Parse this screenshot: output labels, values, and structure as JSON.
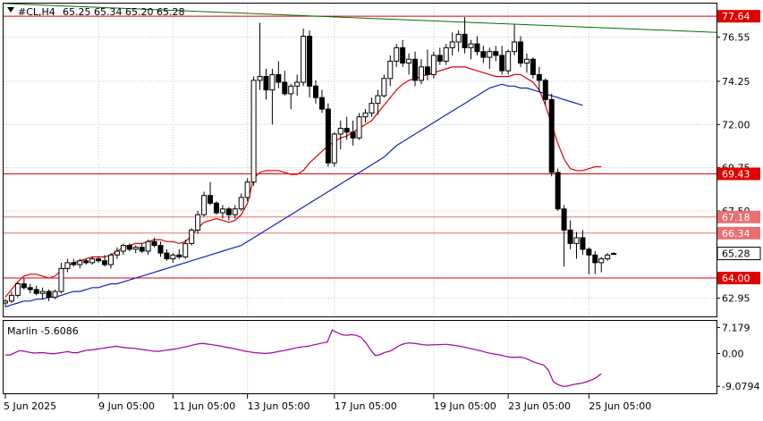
{
  "header": {
    "symbol": "#CL,H4",
    "ohlc": "65.25 65.34 65.20 65.28"
  },
  "indicator": {
    "label": "Marlin -5.6086",
    "levels": [
      "7.179",
      "0.00",
      "-9.0794"
    ],
    "values": [
      -0.4,
      -0.4,
      0.2,
      0.8,
      0.6,
      0.3,
      0.1,
      0.2,
      0.2,
      0.0,
      -0.1,
      0.1,
      0.3,
      0.5,
      0.2,
      0.2,
      0.6,
      0.9,
      1.0,
      1.2,
      1.4,
      1.6,
      1.8,
      2.0,
      1.8,
      1.6,
      1.5,
      1.4,
      1.2,
      1.0,
      0.8,
      0.6,
      0.6,
      0.8,
      1.0,
      1.2,
      1.4,
      1.7,
      2.0,
      2.3,
      2.6,
      2.8,
      2.6,
      2.4,
      2.2,
      2.0,
      1.7,
      1.5,
      1.2,
      0.9,
      0.6,
      0.4,
      0.2,
      0.1,
      0.0,
      0.1,
      0.3,
      0.6,
      0.8,
      1.1,
      1.4,
      1.7,
      1.9,
      2.0,
      2.3,
      2.6,
      2.9,
      3.2,
      6.5,
      5.8,
      5.2,
      5.0,
      5.2,
      5.0,
      4.5,
      3.0,
      1.0,
      -0.6,
      -0.3,
      0.3,
      0.6,
      1.4,
      2.2,
      2.7,
      2.9,
      2.8,
      2.6,
      2.4,
      2.3,
      2.4,
      2.4,
      2.5,
      2.5,
      2.3,
      2.1,
      1.9,
      1.6,
      1.3,
      1.0,
      0.7,
      0.3,
      0.0,
      -0.2,
      -0.4,
      -0.8,
      -1.0,
      -1.1,
      -1.0,
      -1.2,
      -1.8,
      -2.4,
      -2.8,
      -3.2,
      -4.6,
      -7.8,
      -8.6,
      -9.1,
      -9.0,
      -8.6,
      -8.4,
      -8.2,
      -7.8,
      -7.3,
      -6.6,
      -5.6
    ]
  },
  "price_axis": {
    "ticks": [
      "76.55",
      "74.25",
      "72.00",
      "69.75",
      "67.50",
      "65.28",
      "62.95"
    ],
    "current": "65.28"
  },
  "levels": [
    {
      "label": "77.64",
      "value": 77.64
    },
    {
      "label": "69.43",
      "value": 69.43
    },
    {
      "label": "67.18",
      "value": 67.18
    },
    {
      "label": "66.34",
      "value": 66.34
    },
    {
      "label": "64.00",
      "value": 64.0
    }
  ],
  "time_axis": {
    "ticks": [
      "5 Jun 2025",
      "9 Jun 05:00",
      "11 Jun 05:00",
      "13 Jun 05:00",
      "17 Jun 05:00",
      "19 Jun 05:00",
      "23 Jun 05:00",
      "25 Jun 05:00"
    ]
  },
  "colors": {
    "bull": "#ffffff",
    "bear": "#000000",
    "level_red": "#e00000",
    "level_box": "#e00000",
    "level_box_light": "#e87070",
    "band_red": "#e00000",
    "ma_blue": "#1020c0",
    "trend_green": "#007000",
    "marlin": "#a000a0",
    "grid": "#c8c8c8"
  },
  "chart_data": {
    "type": "candlestick",
    "title": "#CL,H4",
    "candles": [
      [
        62.7,
        62.9,
        62.5,
        62.8
      ],
      [
        62.8,
        63.3,
        62.7,
        63.1
      ],
      [
        63.1,
        63.8,
        63.0,
        63.7
      ],
      [
        63.7,
        64.0,
        63.4,
        63.5
      ],
      [
        63.5,
        63.7,
        63.2,
        63.4
      ],
      [
        63.4,
        63.6,
        63.1,
        63.2
      ],
      [
        63.2,
        63.5,
        62.9,
        63.3
      ],
      [
        63.3,
        63.4,
        62.8,
        63.0
      ],
      [
        63.0,
        63.4,
        62.9,
        63.3
      ],
      [
        63.3,
        64.8,
        63.2,
        64.5
      ],
      [
        64.5,
        65.0,
        64.3,
        64.8
      ],
      [
        64.8,
        65.0,
        64.6,
        64.7
      ],
      [
        64.7,
        65.0,
        64.5,
        64.9
      ],
      [
        64.9,
        65.0,
        64.7,
        64.8
      ],
      [
        64.8,
        65.1,
        64.7,
        65.0
      ],
      [
        65.0,
        65.1,
        64.8,
        64.9
      ],
      [
        64.9,
        65.2,
        64.6,
        64.7
      ],
      [
        64.7,
        65.3,
        64.5,
        65.2
      ],
      [
        65.2,
        65.6,
        65.0,
        65.4
      ],
      [
        65.4,
        65.8,
        65.2,
        65.7
      ],
      [
        65.7,
        65.8,
        65.4,
        65.5
      ],
      [
        65.5,
        65.7,
        65.3,
        65.6
      ],
      [
        65.6,
        65.8,
        65.3,
        65.4
      ],
      [
        65.4,
        66.0,
        65.2,
        65.9
      ],
      [
        65.9,
        66.1,
        65.6,
        65.7
      ],
      [
        65.7,
        65.9,
        65.1,
        65.3
      ],
      [
        65.3,
        65.5,
        64.9,
        65.0
      ],
      [
        65.0,
        65.3,
        64.8,
        65.2
      ],
      [
        65.2,
        65.5,
        65.0,
        65.1
      ],
      [
        65.1,
        66.0,
        65.0,
        65.8
      ],
      [
        65.8,
        66.6,
        65.7,
        66.5
      ],
      [
        66.5,
        67.5,
        66.3,
        67.3
      ],
      [
        67.3,
        68.5,
        67.2,
        68.3
      ],
      [
        68.3,
        69.0,
        67.8,
        67.9
      ],
      [
        67.9,
        68.0,
        67.3,
        67.4
      ],
      [
        67.4,
        67.8,
        67.1,
        67.6
      ],
      [
        67.6,
        67.7,
        67.0,
        67.3
      ],
      [
        67.3,
        67.8,
        67.1,
        67.6
      ],
      [
        67.6,
        68.4,
        67.5,
        68.2
      ],
      [
        68.2,
        69.2,
        68.0,
        69.0
      ],
      [
        69.0,
        74.5,
        68.8,
        74.3
      ],
      [
        74.3,
        77.3,
        73.8,
        74.5
      ],
      [
        74.5,
        74.9,
        73.3,
        73.8
      ],
      [
        73.8,
        74.9,
        72.0,
        74.6
      ],
      [
        74.6,
        75.3,
        73.9,
        74.2
      ],
      [
        74.2,
        74.8,
        73.5,
        73.6
      ],
      [
        73.6,
        74.1,
        72.8,
        74.0
      ],
      [
        74.0,
        74.6,
        73.5,
        74.2
      ],
      [
        74.2,
        77.0,
        74.0,
        76.6
      ],
      [
        76.6,
        76.9,
        73.4,
        74.0
      ],
      [
        74.0,
        74.3,
        73.1,
        73.4
      ],
      [
        73.4,
        73.8,
        72.6,
        72.8
      ],
      [
        72.8,
        73.1,
        69.8,
        70.0
      ],
      [
        70.0,
        71.6,
        69.8,
        71.5
      ],
      [
        71.5,
        72.2,
        70.7,
        71.8
      ],
      [
        71.8,
        72.4,
        71.2,
        71.6
      ],
      [
        71.6,
        72.2,
        70.9,
        71.3
      ],
      [
        71.3,
        72.6,
        71.2,
        72.4
      ],
      [
        72.4,
        72.8,
        72.1,
        72.6
      ],
      [
        72.6,
        73.4,
        72.4,
        73.1
      ],
      [
        73.1,
        73.8,
        72.5,
        73.5
      ],
      [
        73.5,
        74.6,
        73.4,
        74.4
      ],
      [
        74.4,
        75.6,
        74.0,
        75.3
      ],
      [
        75.3,
        76.2,
        75.0,
        76.0
      ],
      [
        76.0,
        76.4,
        75.0,
        75.2
      ],
      [
        75.2,
        75.7,
        74.6,
        75.4
      ],
      [
        75.4,
        75.8,
        74.0,
        74.3
      ],
      [
        74.3,
        75.4,
        74.1,
        75.0
      ],
      [
        75.0,
        75.9,
        74.3,
        74.6
      ],
      [
        74.6,
        75.8,
        74.4,
        75.6
      ],
      [
        75.6,
        76.0,
        75.1,
        75.3
      ],
      [
        75.3,
        76.2,
        75.1,
        76.0
      ],
      [
        76.0,
        76.8,
        75.6,
        76.3
      ],
      [
        76.3,
        76.9,
        75.8,
        76.7
      ],
      [
        76.7,
        77.6,
        75.7,
        76.0
      ],
      [
        76.0,
        76.4,
        75.4,
        76.2
      ],
      [
        76.2,
        76.6,
        75.6,
        75.8
      ],
      [
        75.8,
        76.1,
        75.2,
        75.5
      ],
      [
        75.5,
        76.0,
        74.9,
        75.8
      ],
      [
        75.8,
        76.1,
        75.3,
        75.6
      ],
      [
        75.6,
        76.1,
        74.6,
        74.8
      ],
      [
        74.8,
        75.9,
        74.6,
        75.8
      ],
      [
        75.8,
        77.2,
        75.6,
        76.3
      ],
      [
        76.3,
        76.6,
        75.0,
        75.2
      ],
      [
        75.2,
        75.7,
        74.7,
        75.4
      ],
      [
        75.4,
        75.5,
        74.4,
        74.6
      ],
      [
        74.6,
        75.0,
        73.7,
        74.3
      ],
      [
        74.3,
        74.4,
        73.0,
        73.3
      ],
      [
        73.3,
        73.6,
        69.3,
        69.5
      ],
      [
        69.5,
        69.7,
        67.5,
        67.6
      ],
      [
        67.6,
        67.8,
        64.6,
        66.5
      ],
      [
        66.5,
        67.0,
        65.5,
        65.8
      ],
      [
        65.8,
        66.4,
        65.0,
        66.1
      ],
      [
        66.1,
        66.5,
        65.2,
        65.5
      ],
      [
        65.5,
        65.6,
        64.2,
        65.2
      ],
      [
        65.2,
        65.4,
        64.2,
        64.8
      ],
      [
        64.8,
        65.1,
        64.3,
        65.0
      ],
      [
        65.0,
        65.3,
        64.9,
        65.2
      ],
      [
        65.25,
        65.34,
        65.2,
        65.28
      ]
    ],
    "upper_band": [
      63.0,
      63.4,
      63.8,
      64.1,
      64.2,
      64.2,
      64.1,
      64.0,
      64.1,
      64.4,
      64.6,
      64.8,
      64.9,
      65.0,
      65.1,
      65.1,
      65.1,
      65.2,
      65.4,
      65.6,
      65.7,
      65.8,
      65.8,
      65.9,
      66.0,
      66.0,
      65.9,
      65.9,
      65.8,
      65.9,
      66.2,
      66.6,
      66.9,
      67.0,
      67.1,
      67.0,
      66.9,
      67.0,
      67.3,
      67.9,
      69.2,
      69.5,
      69.6,
      69.6,
      69.6,
      69.5,
      69.4,
      69.4,
      69.6,
      70.0,
      70.3,
      70.6,
      70.9,
      71.1,
      71.3,
      71.4,
      71.6,
      71.8,
      72.0,
      72.2,
      72.6,
      73.0,
      73.4,
      73.8,
      74.1,
      74.3,
      74.4,
      74.5,
      74.6,
      74.7,
      74.8,
      74.9,
      75.0,
      75.0,
      75.0,
      74.9,
      74.8,
      74.7,
      74.6,
      74.5,
      74.5,
      74.5,
      74.6,
      74.6,
      74.4,
      74.2,
      73.8,
      73.0,
      72.0,
      71.0,
      70.2,
      69.7,
      69.6,
      69.6,
      69.7,
      69.8,
      69.8
    ],
    "ma": [
      62.5,
      62.6,
      62.7,
      62.8,
      62.8,
      62.9,
      62.9,
      63.0,
      63.0,
      63.1,
      63.2,
      63.3,
      63.3,
      63.4,
      63.5,
      63.5,
      63.6,
      63.7,
      63.7,
      63.8,
      63.9,
      64.0,
      64.1,
      64.2,
      64.3,
      64.4,
      64.5,
      64.6,
      64.7,
      64.8,
      64.9,
      65.0,
      65.1,
      65.2,
      65.3,
      65.4,
      65.5,
      65.6,
      65.7,
      65.9,
      66.1,
      66.3,
      66.5,
      66.7,
      66.9,
      67.1,
      67.3,
      67.5,
      67.7,
      67.9,
      68.1,
      68.3,
      68.5,
      68.7,
      68.9,
      69.1,
      69.3,
      69.5,
      69.7,
      69.9,
      70.1,
      70.3,
      70.6,
      70.9,
      71.1,
      71.3,
      71.5,
      71.7,
      71.9,
      72.1,
      72.3,
      72.5,
      72.7,
      72.9,
      73.1,
      73.3,
      73.5,
      73.7,
      73.9,
      74.0,
      74.1,
      74.0,
      74.0,
      73.9,
      73.9,
      73.8,
      73.7,
      73.6,
      73.5,
      73.4,
      73.3,
      73.2,
      73.1,
      73.0
    ],
    "trendline": {
      "from": [
        0,
        78.3
      ],
      "to": [
        97,
        76.8
      ]
    },
    "xlabel": "",
    "ylabel": "",
    "ylim": [
      62.0,
      78.3
    ]
  }
}
